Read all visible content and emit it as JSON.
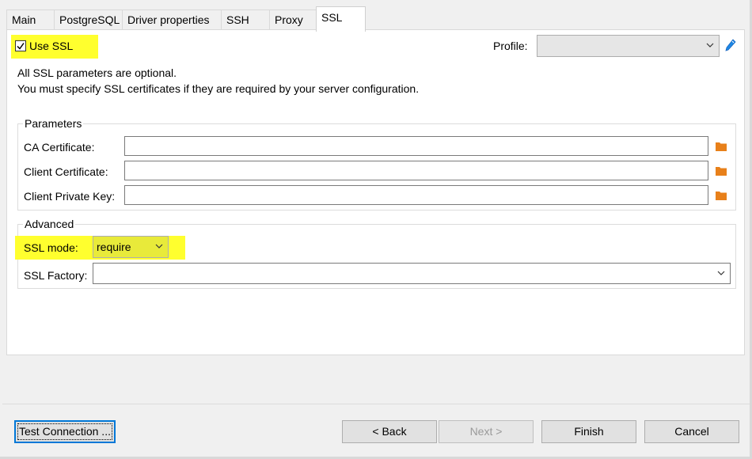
{
  "tabs": [
    "Main",
    "PostgreSQL",
    "Driver properties",
    "SSH",
    "Proxy",
    "SSL"
  ],
  "active_tab": "SSL",
  "use_ssl": {
    "label": "Use SSL",
    "checked": true
  },
  "profile": {
    "label": "Profile:",
    "value": ""
  },
  "info": {
    "line1": "All SSL parameters are optional.",
    "line2": "You must specify SSL certificates if they are required by your server configuration."
  },
  "parameters": {
    "title": "Parameters",
    "ca_certificate": {
      "label": "CA Certificate:",
      "value": ""
    },
    "client_certificate": {
      "label": "Client Certificate:",
      "value": ""
    },
    "client_private_key": {
      "label": "Client Private Key:",
      "value": ""
    }
  },
  "advanced": {
    "title": "Advanced",
    "ssl_mode": {
      "label": "SSL mode:",
      "value": "require"
    },
    "ssl_factory": {
      "label": "SSL Factory:",
      "value": ""
    }
  },
  "buttons": {
    "test_connection": "Test Connection ...",
    "back": "< Back",
    "next": "Next >",
    "finish": "Finish",
    "cancel": "Cancel"
  },
  "colors": {
    "highlight": "#ffff2e",
    "folder": "#e8801a",
    "pencil": "#1e88e5",
    "focus": "#0078d7"
  },
  "icons": [
    "chevron-down-icon",
    "pencil-icon",
    "folder-icon",
    "checkmark-icon"
  ]
}
